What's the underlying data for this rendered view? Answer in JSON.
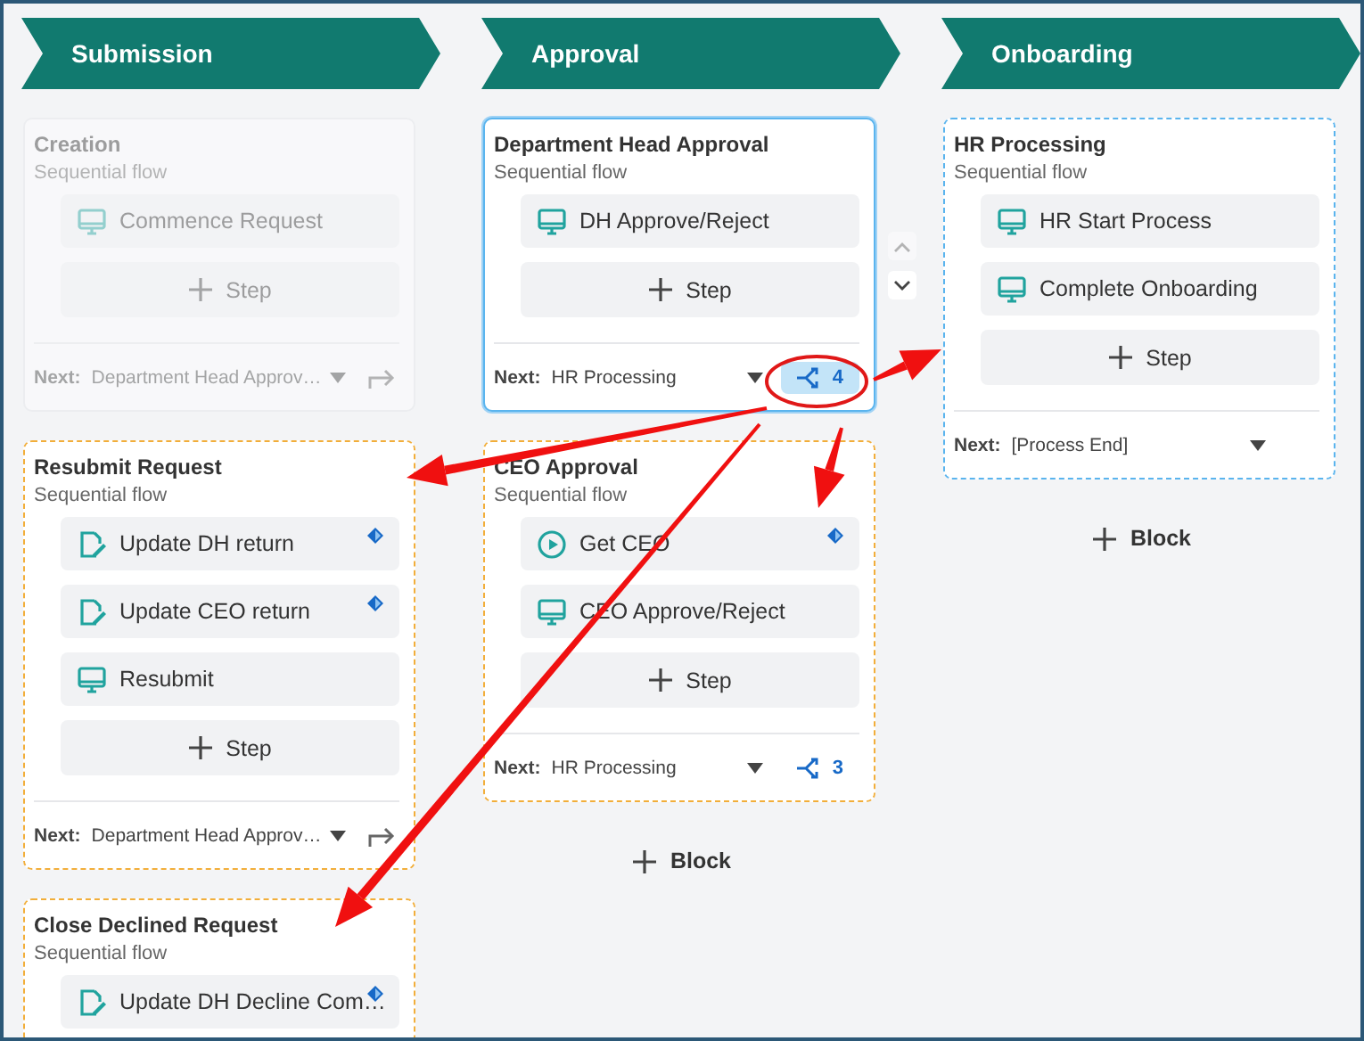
{
  "columns": [
    {
      "title": "Submission",
      "cards": [
        {
          "title": "Creation",
          "subtitle": "Sequential flow",
          "kind": "plain",
          "disabled": true,
          "selected": false,
          "steps": [
            {
              "label": "Commence Request",
              "kind": "screen",
              "marked": false
            }
          ],
          "add_step": "Step",
          "next_label": "Next:",
          "next_value": "Department Head Approv…",
          "exit": {
            "kind": "link"
          }
        },
        {
          "title": "Resubmit Request",
          "subtitle": "Sequential flow",
          "kind": "pending",
          "disabled": false,
          "selected": false,
          "steps": [
            {
              "label": "Update DH return",
              "kind": "form",
              "marked": true
            },
            {
              "label": "Update CEO return",
              "kind": "form",
              "marked": true
            },
            {
              "label": "Resubmit",
              "kind": "screen",
              "marked": false
            }
          ],
          "add_step": "Step",
          "next_label": "Next:",
          "next_value": "Department Head Approv…",
          "exit": {
            "kind": "link"
          }
        },
        {
          "title": "Close Declined Request",
          "subtitle": "Sequential flow",
          "kind": "pending",
          "disabled": false,
          "selected": false,
          "steps": [
            {
              "label": "Update DH Decline Com…",
              "kind": "form",
              "marked": true
            }
          ]
        }
      ]
    },
    {
      "title": "Approval",
      "add_block": "Block",
      "cards": [
        {
          "title": "Department Head Approval",
          "subtitle": "Sequential flow",
          "kind": "current",
          "disabled": false,
          "selected": true,
          "steps": [
            {
              "label": "DH Approve/Reject",
              "kind": "screen",
              "marked": false
            }
          ],
          "add_step": "Step",
          "next_label": "Next:",
          "next_value": "HR Processing",
          "exit": {
            "kind": "branch",
            "count": "4",
            "active": true,
            "annotated": true
          }
        },
        {
          "title": "CEO Approval",
          "subtitle": "Sequential flow",
          "kind": "pending",
          "disabled": false,
          "selected": false,
          "steps": [
            {
              "label": "Get CEO",
              "kind": "play",
              "marked": true
            },
            {
              "label": "CEO Approve/Reject",
              "kind": "screen",
              "marked": false
            }
          ],
          "add_step": "Step",
          "next_label": "Next:",
          "next_value": "HR Processing",
          "exit": {
            "kind": "branch",
            "count": "3",
            "active": false,
            "annotated": false
          }
        }
      ]
    },
    {
      "title": "Onboarding",
      "add_block": "Block",
      "cards": [
        {
          "title": "HR Processing",
          "subtitle": "Sequential flow",
          "kind": "target",
          "disabled": false,
          "selected": false,
          "steps": [
            {
              "label": "HR Start Process",
              "kind": "screen",
              "marked": false
            },
            {
              "label": "Complete Onboarding",
              "kind": "screen",
              "marked": false
            }
          ],
          "add_step": "Step",
          "next_label": "Next:",
          "next_value": "[Process End]",
          "exit": {
            "kind": "none"
          }
        }
      ]
    }
  ]
}
